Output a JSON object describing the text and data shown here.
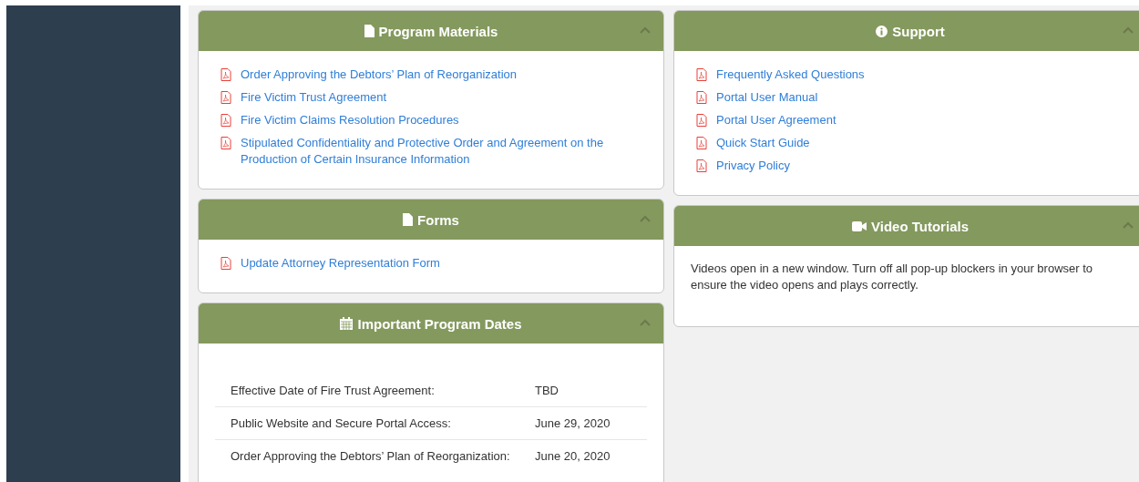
{
  "columns": [
    {
      "panels": [
        {
          "kind": "links",
          "title": "Program Materials",
          "expanded": true,
          "links": [
            "Order Approving the Debtors’ Plan of Reorganization",
            "Fire Victim Trust Agreement",
            "Fire Victim Claims Resolution Procedures",
            "Stipulated Confidentiality and Protective Order and Agreement on the Production of Certain Insurance Information"
          ]
        },
        {
          "kind": "links",
          "title": "Forms",
          "expanded": true,
          "links": [
            "Update Attorney Representation Form"
          ]
        },
        {
          "kind": "dates",
          "title": "Important Program Dates",
          "expanded": true,
          "rows": [
            {
              "label": "Effective Date of Fire Trust Agreement:",
              "date": "TBD"
            },
            {
              "label": "Public Website and Secure Portal Access:",
              "date": "June 29, 2020"
            },
            {
              "label": "Order Approving the Debtors’ Plan of Reorganization:",
              "date": "June 20, 2020"
            }
          ]
        }
      ]
    },
    {
      "panels": [
        {
          "kind": "links",
          "title": "Support",
          "expanded": true,
          "links": [
            "Frequently Asked Questions",
            "Portal User Manual",
            "Portal User Agreement",
            "Quick Start Guide",
            "Privacy Policy"
          ]
        },
        {
          "kind": "text",
          "title": "Video Tutorials",
          "expanded": true,
          "text": "Videos open in a new window. Turn off all pop-up blockers in your browser to ensure the video opens and plays correctly."
        }
      ]
    }
  ]
}
